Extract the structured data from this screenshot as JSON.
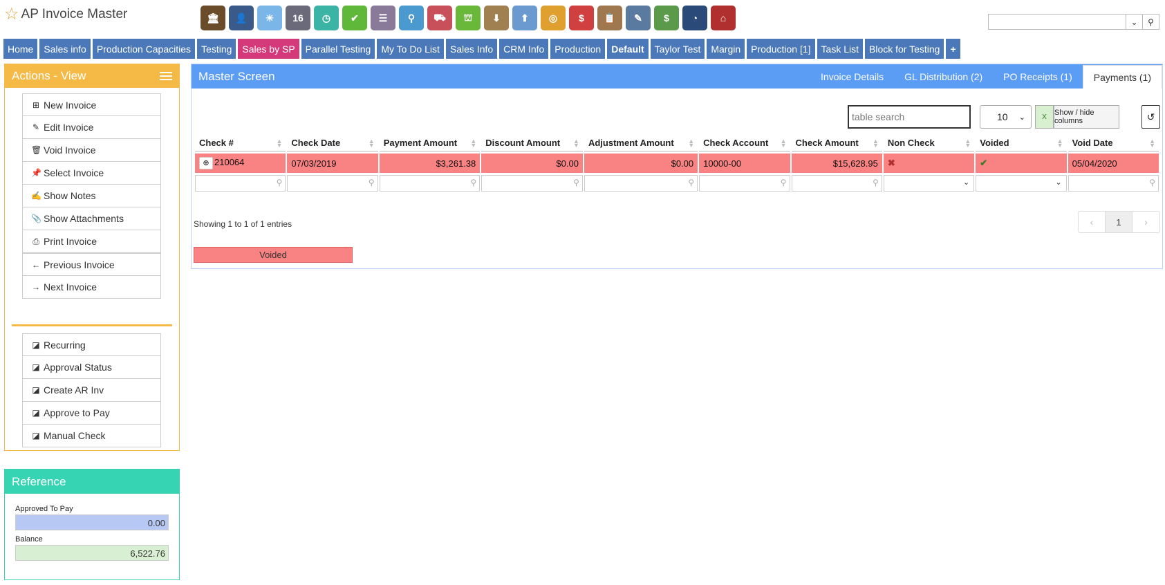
{
  "header": {
    "title": "AP Invoice Master",
    "search_value": ""
  },
  "toolbar": [
    {
      "name": "bank-icon",
      "color": "#6b4c2a",
      "glyph": "🏛"
    },
    {
      "name": "user-icon",
      "color": "#3a5a8a",
      "glyph": "👤"
    },
    {
      "name": "weather-icon",
      "color": "#7ab6e8",
      "glyph": "☀"
    },
    {
      "name": "calendar-icon",
      "color": "#6a6a7a",
      "glyph": "16"
    },
    {
      "name": "clock-icon",
      "color": "#3bb3a5",
      "glyph": "◷"
    },
    {
      "name": "checkmark-icon",
      "color": "#5fb83a",
      "glyph": "✔"
    },
    {
      "name": "spreadsheet-icon",
      "color": "#8a7a9a",
      "glyph": "☰"
    },
    {
      "name": "magnifier-icon",
      "color": "#4a9ad0",
      "glyph": "⚲"
    },
    {
      "name": "truck-icon",
      "color": "#c8505a",
      "glyph": "⛟"
    },
    {
      "name": "basket-icon",
      "color": "#6ab83a",
      "glyph": "⛫"
    },
    {
      "name": "inbox-download-icon",
      "color": "#a08050",
      "glyph": "⬇"
    },
    {
      "name": "outbox-upload-icon",
      "color": "#6a9ad0",
      "glyph": "⬆"
    },
    {
      "name": "coins-icon",
      "color": "#e0a030",
      "glyph": "◎"
    },
    {
      "name": "price-chat-icon",
      "color": "#d04040",
      "glyph": "$"
    },
    {
      "name": "clipboard-icon",
      "color": "#a07850",
      "glyph": "📋"
    },
    {
      "name": "pencil-icon",
      "color": "#5a7aa0",
      "glyph": "✎"
    },
    {
      "name": "money-icon",
      "color": "#5a9a4a",
      "glyph": "$"
    },
    {
      "name": "dashboard-icon",
      "color": "#2a4a7a",
      "glyph": "◔"
    },
    {
      "name": "factory-icon",
      "color": "#b03030",
      "glyph": "⌂"
    }
  ],
  "tabs": [
    {
      "label": "Home",
      "active": false,
      "bold": false
    },
    {
      "label": "Sales info",
      "active": false,
      "bold": false
    },
    {
      "label": "Production Capacities",
      "active": false,
      "bold": false
    },
    {
      "label": "Testing",
      "active": false,
      "bold": false
    },
    {
      "label": "Sales by SP",
      "active": true,
      "bold": false
    },
    {
      "label": "Parallel Testing",
      "active": false,
      "bold": false
    },
    {
      "label": "My To Do List",
      "active": false,
      "bold": false
    },
    {
      "label": "Sales Info",
      "active": false,
      "bold": false
    },
    {
      "label": "CRM Info",
      "active": false,
      "bold": false
    },
    {
      "label": "Production",
      "active": false,
      "bold": false
    },
    {
      "label": "Default",
      "active": false,
      "bold": true
    },
    {
      "label": "Taylor Test",
      "active": false,
      "bold": false
    },
    {
      "label": "Margin",
      "active": false,
      "bold": false
    },
    {
      "label": "Production [1]",
      "active": false,
      "bold": false
    },
    {
      "label": "Task List",
      "active": false,
      "bold": false
    },
    {
      "label": "Block for Testing",
      "active": false,
      "bold": false
    },
    {
      "label": "+",
      "active": false,
      "bold": true
    }
  ],
  "actions": {
    "title": "Actions - View",
    "group1": [
      {
        "label": "New Invoice",
        "icon": "plus-square-icon",
        "glyph": "⊞"
      },
      {
        "label": "Edit Invoice",
        "icon": "pencil-icon",
        "glyph": "✎"
      },
      {
        "label": "Void Invoice",
        "icon": "trash-icon",
        "glyph": "🗑"
      },
      {
        "label": "Select Invoice",
        "icon": "pin-icon",
        "glyph": "📌"
      },
      {
        "label": "Show Notes",
        "icon": "edit-note-icon",
        "glyph": "✍"
      },
      {
        "label": "Show Attachments",
        "icon": "paperclip-icon",
        "glyph": "📎"
      },
      {
        "label": "Print Invoice",
        "icon": "printer-icon",
        "glyph": "⎙"
      }
    ],
    "group2": [
      {
        "label": "Previous Invoice",
        "icon": "arrow-left-icon",
        "glyph": "←"
      },
      {
        "label": "Next Invoice",
        "icon": "arrow-right-icon",
        "glyph": "→"
      }
    ],
    "group3": [
      {
        "label": "Recurring",
        "icon": "external-link-icon",
        "glyph": "◪"
      },
      {
        "label": "Approval Status",
        "icon": "external-link-icon",
        "glyph": "◪"
      },
      {
        "label": "Create AR Inv",
        "icon": "external-link-icon",
        "glyph": "◪"
      },
      {
        "label": "Approve to Pay",
        "icon": "external-link-icon",
        "glyph": "◪"
      },
      {
        "label": "Manual Check",
        "icon": "external-link-icon",
        "glyph": "◪"
      }
    ]
  },
  "reference": {
    "title": "Reference",
    "approved_label": "Approved To Pay",
    "approved_value": "0.00",
    "approved_color": "#b7c8f5",
    "balance_label": "Balance",
    "balance_value": "6,522.76",
    "balance_color": "#d9efd3"
  },
  "main": {
    "title": "Master Screen",
    "tabs": [
      {
        "label": "Invoice Details",
        "active": false
      },
      {
        "label": "GL Distribution (2)",
        "active": false
      },
      {
        "label": "PO Receipts (1)",
        "active": false
      },
      {
        "label": "Payments (1)",
        "active": true
      }
    ],
    "search_placeholder": "table search",
    "page_size": "10",
    "cols_label": "Show / hide columns",
    "columns": [
      "Check #",
      "Check Date",
      "Payment Amount",
      "Discount Amount",
      "Adjustment Amount",
      "Check Account",
      "Check Amount",
      "Non Check",
      "Voided",
      "Void Date"
    ],
    "column_widths": [],
    "rows": [
      {
        "check_no": "210064",
        "check_date": "07/03/2019",
        "payment_amount": "$3,261.38",
        "discount_amount": "$0.00",
        "adjustment_amount": "$0.00",
        "check_account": "10000-00",
        "check_amount": "$15,628.95",
        "non_check": "✖",
        "voided": "✔",
        "void_date": "05/04/2020"
      }
    ],
    "filters": [
      "text",
      "text",
      "text",
      "text",
      "text",
      "text",
      "text",
      "select",
      "select",
      "text"
    ],
    "showing": "Showing 1 to 1 of 1 entries",
    "pager": {
      "prev": "‹",
      "current": "1",
      "next": "›"
    },
    "legend_label": "Voided",
    "voided_color": "#f98282"
  }
}
